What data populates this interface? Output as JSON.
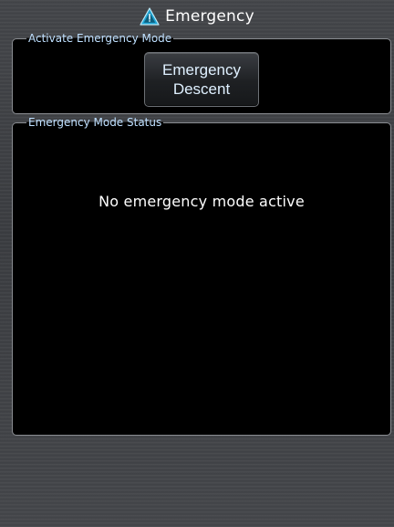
{
  "header": {
    "title": "Emergency",
    "icon": "warning-triangle-icon",
    "icon_color": "#1fa6d6"
  },
  "activate_panel": {
    "legend": "Activate Emergency Mode",
    "button": {
      "line1": "Emergency",
      "line2": "Descent"
    }
  },
  "status_panel": {
    "legend": "Emergency Mode Status",
    "message": "No emergency mode active"
  },
  "colors": {
    "background": "#3d3f43",
    "panel": "#000000",
    "legend_text": "#bfe0ff",
    "accent": "#1fa6d6"
  }
}
